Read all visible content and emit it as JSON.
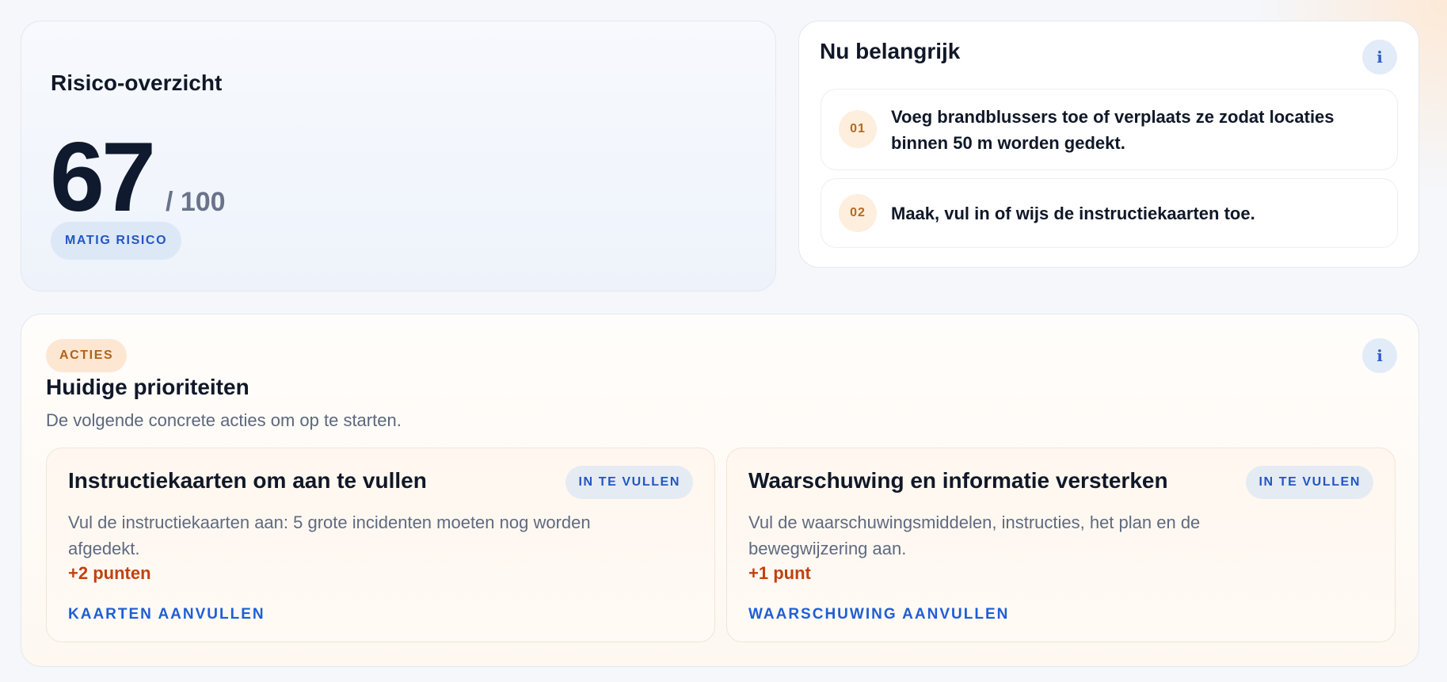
{
  "risk_overview": {
    "title": "Risico-overzicht",
    "score": "67",
    "score_max": "/ 100",
    "level_badge": "MATIG RISICO"
  },
  "important_now": {
    "title": "Nu belangrijk",
    "info_label": "i",
    "items": [
      {
        "number": "01",
        "text": "Voeg brandblussers toe of verplaats ze zodat locaties binnen 50 m worden gedekt."
      },
      {
        "number": "02",
        "text": "Maak, vul in of wijs de instructiekaarten toe."
      }
    ]
  },
  "actions": {
    "badge": "ACTIES",
    "info_label": "i",
    "title": "Huidige prioriteiten",
    "subtitle": "De volgende concrete acties om op te starten.",
    "tasks": [
      {
        "title": "Instructiekaarten om aan te vullen",
        "status": "IN TE VULLEN",
        "description": "Vul de instructiekaarten aan: 5 grote incidenten moeten nog worden afgedekt.",
        "points": "+2 punten",
        "link": "KAARTEN AANVULLEN"
      },
      {
        "title": "Waarschuwing en informatie versterken",
        "status": "IN TE VULLEN",
        "description": "Vul de waarschuwingsmiddelen, instructies, het plan en de bewegwijzering aan.",
        "points": "+1 punt",
        "link": "WAARSCHUWING AANVULLEN"
      }
    ]
  },
  "colors": {
    "accent_blue": "#1e5ed6",
    "orange_points": "#c2410c",
    "badge_orange_bg": "#fde7d2",
    "badge_blue_bg": "#dde8f7"
  }
}
